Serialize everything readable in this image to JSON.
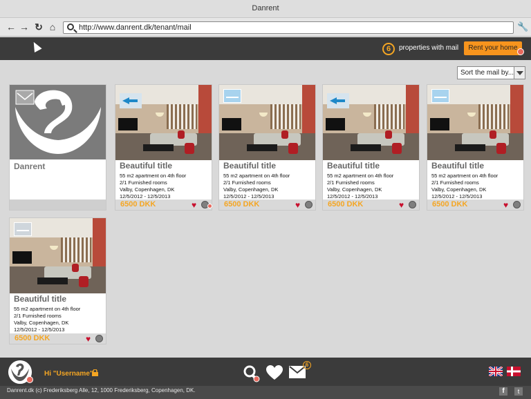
{
  "window": {
    "title": "Danrent"
  },
  "browser": {
    "url": "http://www.danrent.dk/tenant/mail"
  },
  "header": {
    "mail_count": "6",
    "mail_text": "properties with mail",
    "rent_button": "Rent your home"
  },
  "sort": {
    "label": "Sort the mail by..."
  },
  "brand_card": {
    "name": "Danrent"
  },
  "listings": [
    {
      "title": "Beautiful title",
      "line1": "55 m2 apartment on 4th floor",
      "line2": "2/1 Furnished rooms",
      "line3": "Valby, Copenhagen, DK",
      "dates": "12/5/2012 - 12/5/2013",
      "price": "6500 DKK",
      "mail_icon": "reply-arrow-icon"
    },
    {
      "title": "Beautiful title",
      "line1": "55 m2 apartment on 4th floor",
      "line2": "2/1 Furnished rooms",
      "line3": "Valby, Copenhagen, DK",
      "dates": "12/5/2012 - 12/5/2013",
      "price": "6500 DKK",
      "mail_icon": "open-mail-icon"
    },
    {
      "title": "Beautiful title",
      "line1": "55 m2 apartment on 4th floor",
      "line2": "2/1 Furnished rooms",
      "line3": "Valby, Copenhagen, DK",
      "dates": "12/5/2012 - 12/5/2013",
      "price": "6500 DKK",
      "mail_icon": "reply-arrow-icon"
    },
    {
      "title": "Beautiful title",
      "line1": "55 m2 apartment on 4th floor",
      "line2": "2/1 Furnished rooms",
      "line3": "Valby, Copenhagen, DK",
      "dates": "12/5/2012 - 12/5/2013",
      "price": "6500 DKK",
      "mail_icon": "open-mail-icon"
    },
    {
      "title": "Beautiful title",
      "line1": "55 m2 apartment on 4th floor",
      "line2": "2/1 Furnished rooms",
      "line3": "Valby, Copenhagen, DK",
      "dates": "12/5/2012 - 12/5/2013",
      "price": "6500 DKK",
      "mail_icon": "mail-envelope-icon"
    }
  ],
  "footer": {
    "greeting": "Hi \"Username\"",
    "mail_badge": "6",
    "copyright": "Danrent.dk (c) Frederiksberg Alle, 12, 1000 Frederiksberg, Copenhagen, DK."
  },
  "colors": {
    "accent": "#f5a623",
    "dark": "#3b3b3b",
    "heart": "#c8102e"
  }
}
